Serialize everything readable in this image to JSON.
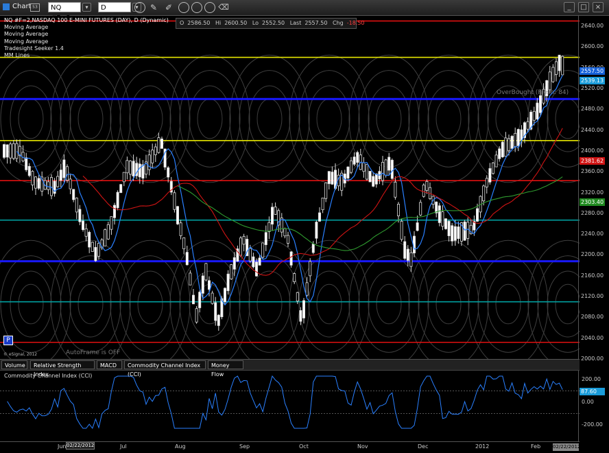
{
  "toolbar": {
    "window_title": "Chart",
    "symbol": "NQ #F=2",
    "interval": "D"
  },
  "quote": {
    "open_label": "O",
    "open": "2586.50",
    "high_label": "Hi",
    "high": "2600.50",
    "low_label": "Lo",
    "low": "2552.50",
    "last_label": "Last",
    "last": "2557.50",
    "chg_label": "Chg",
    "chg": "-18.50"
  },
  "legend": [
    "NQ #F=2,NASDAQ 100 E-MINI FUTURES (DAY), D (Dynamic)",
    "Moving Average",
    "Moving Average",
    "Moving Average",
    "Tradesight Seeker 1.4",
    "MM Lines"
  ],
  "watermark": {
    "esignal": "© eSignal, 2012",
    "autoframe": "AutoFrame is OFF",
    "overbought": "OverBought (Fresh: 84)",
    "p_marker": "P"
  },
  "price_axis": [
    "2640.00",
    "2600.00",
    "2560.00",
    "2520.00",
    "2480.00",
    "2440.00",
    "2400.00",
    "2360.00",
    "2320.00",
    "2280.00",
    "2240.00",
    "2200.00",
    "2160.00",
    "2120.00",
    "2080.00",
    "2040.00",
    "2000.00"
  ],
  "price_tags": [
    {
      "value": "2557.50",
      "color": "#1560d8"
    },
    {
      "value": "2539.13",
      "color": "#1a9bd8"
    },
    {
      "value": "2381.62",
      "color": "#d01414"
    },
    {
      "value": "2303.40",
      "color": "#1f8a1f"
    }
  ],
  "tabs": [
    "Volume",
    "Relative Strength Index",
    "MACD",
    "Commodity Channel Index (CCI)",
    "Money Flow"
  ],
  "cci": {
    "title": "Commodity Channel Index (CCI)",
    "axis": [
      "200.00",
      "0.00",
      "-200.00"
    ],
    "tag": "87.60"
  },
  "x_axis": {
    "months": [
      "Jun",
      "Jul",
      "Aug",
      "Sep",
      "Oct",
      "Nov",
      "Dec",
      "2012",
      "Feb"
    ],
    "cursor_date_left": "02/22/2012",
    "cursor_date_right": "02/22/2012"
  },
  "chart_data": {
    "type": "candlestick",
    "ylim": [
      2000,
      2660
    ],
    "levels": [
      {
        "price": 2650,
        "color": "#e01010"
      },
      {
        "price": 2580,
        "color": "#e6e600"
      },
      {
        "price": 2500,
        "color": "#1818ff"
      },
      {
        "price": 2420,
        "color": "#e6e600"
      },
      {
        "price": 2343,
        "color": "#e01010"
      },
      {
        "price": 2267,
        "color": "#00a0a0"
      },
      {
        "price": 2188,
        "color": "#1818ff"
      },
      {
        "price": 2110,
        "color": "#00a0a0"
      },
      {
        "price": 2032,
        "color": "#e01010"
      }
    ]
  }
}
